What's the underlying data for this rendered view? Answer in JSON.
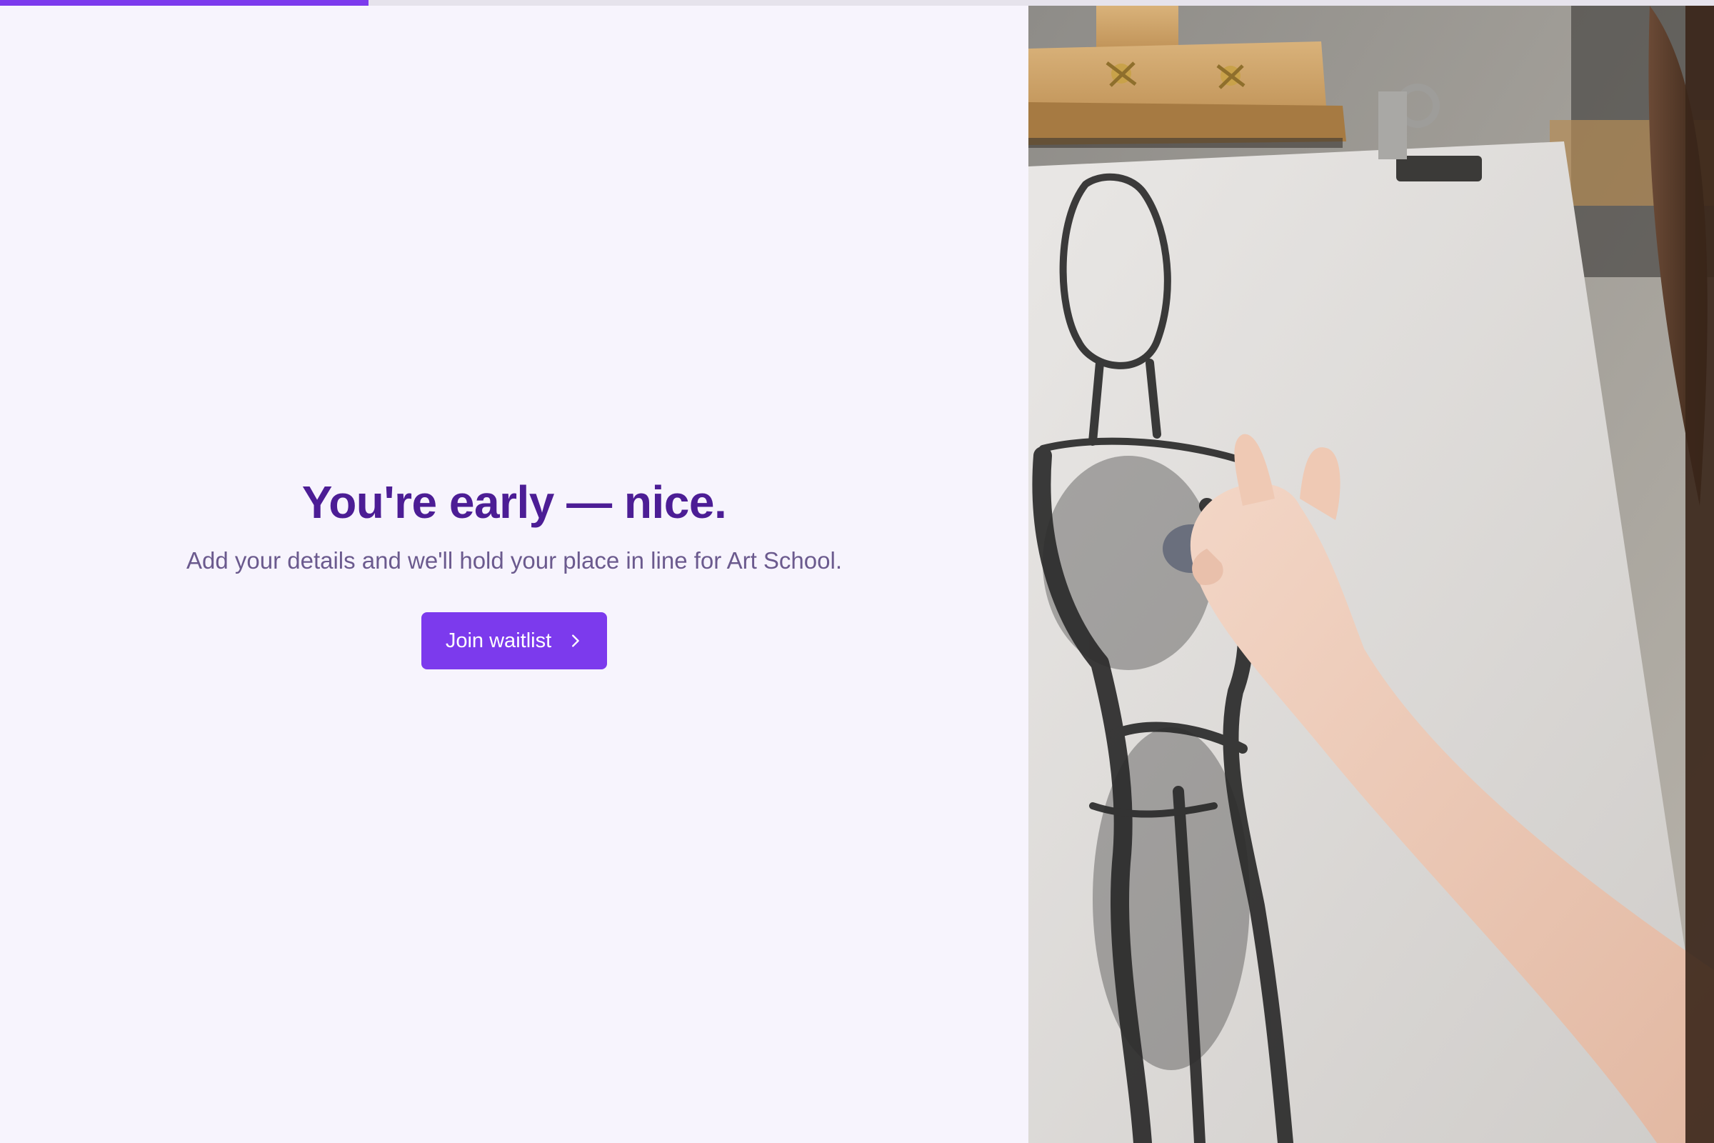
{
  "progress": {
    "value": 0.215,
    "color": "#7c3aed"
  },
  "hero": {
    "headline": "You're early — nice.",
    "subtext": "Add your details and we'll hold your place in line for Art School.",
    "cta_label": "Join waitlist",
    "cta_icon": "chevron-right-icon"
  },
  "image": {
    "subject": "hand sketching a charcoal figure drawing on an easel"
  },
  "colors": {
    "accent": "#7c3aed",
    "headline": "#4c1d95",
    "subtext": "#6b5a8e",
    "background": "#f7f4fd"
  }
}
